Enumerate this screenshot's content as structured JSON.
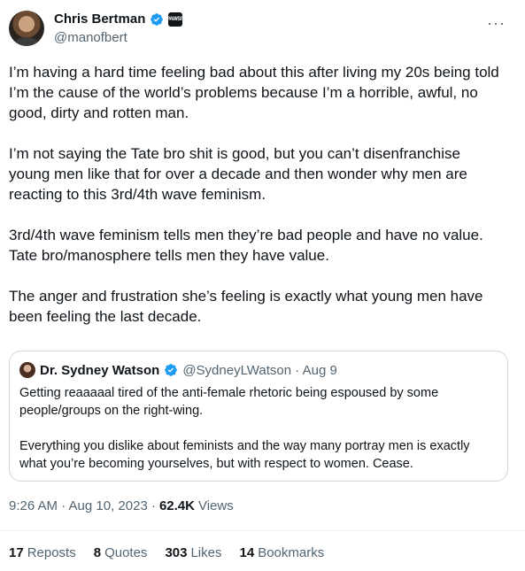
{
  "author": {
    "name": "Chris Bertman",
    "handle": "@manofbert",
    "affiliate_badge": "PAWSIT"
  },
  "more_menu": "···",
  "tweet": {
    "text": "I’m having a hard time feeling bad about this after living my 20s being told I’m the cause of the world’s problems because I’m a horrible, awful, no good, dirty and rotten man.\n\nI’m not saying the Tate bro shit is good, but you can’t disenfranchise young men like that for over a decade and then wonder why men are reacting to this 3rd/4th wave feminism.\n\n3rd/4th wave feminism tells men they’re bad people and have no value. Tate bro/manosphere tells men they have value.\n\nThe anger and frustration she’s feeling is exactly what young men have been feeling the last decade."
  },
  "quoted": {
    "name": "Dr. Sydney Watson",
    "meta": "@SydneyLWatson · Aug 9",
    "text": "Getting reaaaaal tired of the anti-female rhetoric being espoused by some people/groups on the right-wing.\n\nEverything you dislike about feminists and the way many portray men is exactly what you’re becoming yourselves, but with respect to women. Cease."
  },
  "timestamp": {
    "time_date": "9:26 AM · Aug 10, 2023 ·",
    "views_count": "62.4K",
    "views_label": "Views"
  },
  "stats": [
    {
      "count": "17",
      "label": "Reposts"
    },
    {
      "count": "8",
      "label": "Quotes"
    },
    {
      "count": "303",
      "label": "Likes"
    },
    {
      "count": "14",
      "label": "Bookmarks"
    }
  ],
  "colors": {
    "verified": "#1d9bf0",
    "text": "#0f1419",
    "secondary": "#536471",
    "border": "#cfd9de"
  }
}
